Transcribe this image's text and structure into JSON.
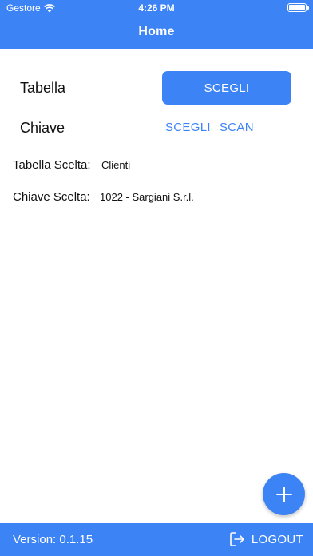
{
  "status_bar": {
    "carrier": "Gestore",
    "time": "4:26 PM"
  },
  "header": {
    "title": "Home"
  },
  "tabella_row": {
    "label": "Tabella",
    "button_label": "SCEGLI"
  },
  "chiave_row": {
    "label": "Chiave",
    "choose_label": "SCEGLI",
    "scan_label": "SCAN"
  },
  "selection": {
    "tabella_label": "Tabella Scelta:",
    "tabella_value": "Clienti",
    "chiave_label": "Chiave Scelta:",
    "chiave_value": "1022 - Sargiani S.r.l."
  },
  "footer": {
    "version": "Version: 0.1.15",
    "logout_label": "LOGOUT"
  },
  "icons": {
    "fab": "plus-icon",
    "logout": "logout-icon",
    "wifi": "wifi-icon",
    "battery": "battery-icon"
  },
  "colors": {
    "accent": "#3c83f6",
    "background": "#ffffff"
  }
}
